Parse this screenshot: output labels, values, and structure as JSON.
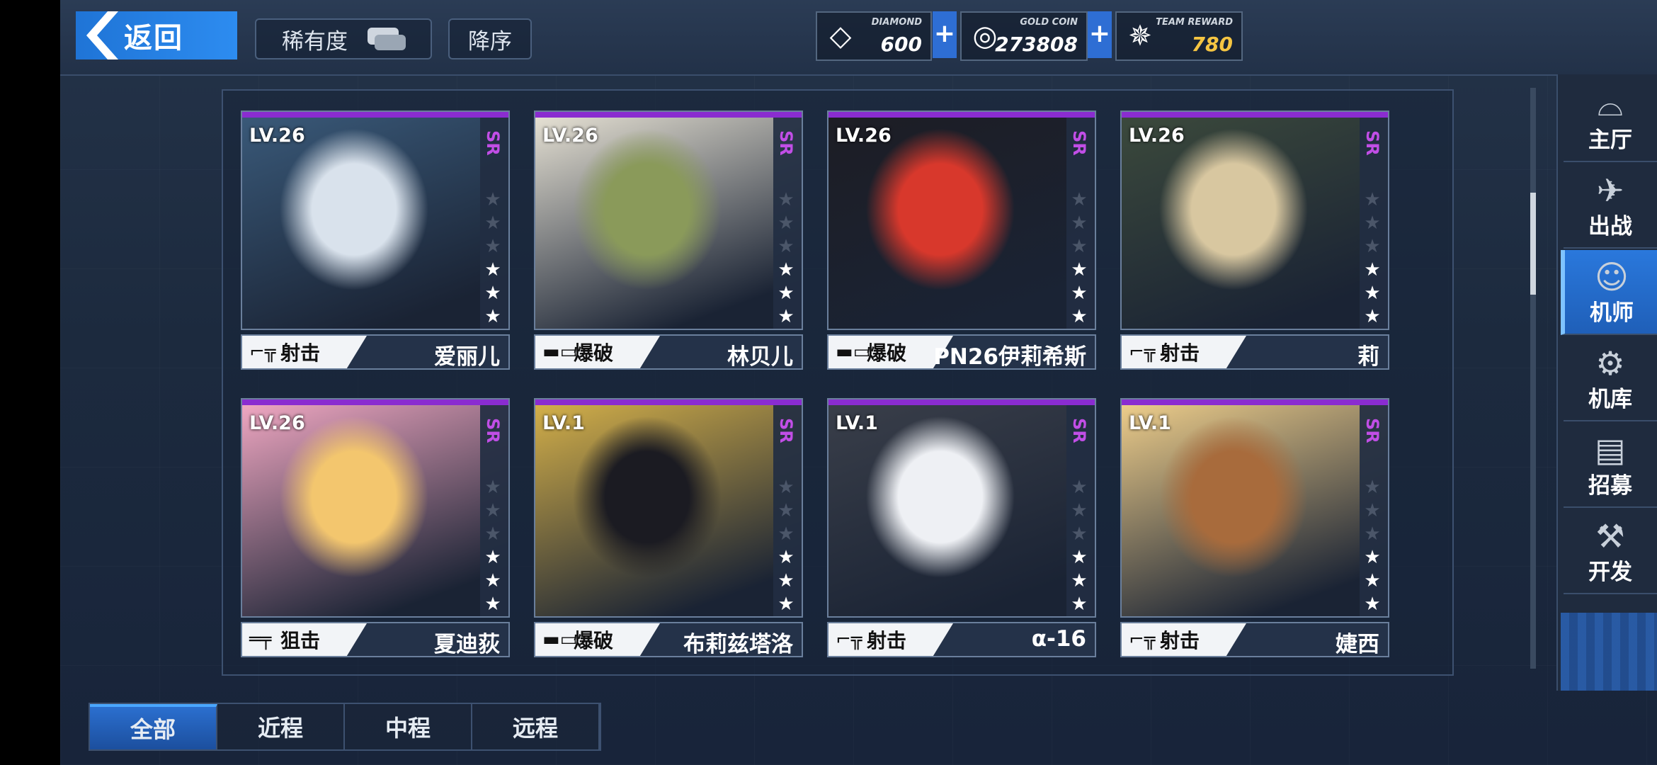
{
  "header": {
    "back_label": "返回",
    "rarity_label": "稀有度",
    "order_label": "降序"
  },
  "resources": {
    "diamond": {
      "caption": "DIAMOND",
      "value": "600"
    },
    "gold": {
      "caption": "GOLD COIN",
      "value": "273808"
    },
    "reward": {
      "caption": "TEAM REWARD",
      "value": "780"
    }
  },
  "nav": [
    {
      "label": "主厅",
      "icon": "hall-icon"
    },
    {
      "label": "出战",
      "icon": "battle-icon"
    },
    {
      "label": "机师",
      "icon": "pilot-icon"
    },
    {
      "label": "机库",
      "icon": "hangar-icon"
    },
    {
      "label": "招募",
      "icon": "recruit-icon"
    },
    {
      "label": "开发",
      "icon": "develop-icon"
    }
  ],
  "active_nav": "机师",
  "cards": [
    {
      "level": "LV.26",
      "rarity": "SR",
      "stars": 3,
      "role": "射击",
      "name": "爱丽儿",
      "colors": [
        "#d9e2ec",
        "#3a5a7a"
      ]
    },
    {
      "level": "LV.26",
      "rarity": "SR",
      "stars": 3,
      "role": "爆破",
      "name": "林贝儿",
      "colors": [
        "#8a9a5a",
        "#e9e4d6"
      ]
    },
    {
      "level": "LV.26",
      "rarity": "SR",
      "stars": 3,
      "role": "爆破",
      "name": "PN26伊莉希斯",
      "colors": [
        "#d8382c",
        "#1d1d24"
      ]
    },
    {
      "level": "LV.26",
      "rarity": "SR",
      "stars": 3,
      "role": "射击",
      "name": "莉",
      "colors": [
        "#d8c7a0",
        "#3c4a3c"
      ]
    },
    {
      "level": "LV.26",
      "rarity": "SR",
      "stars": 3,
      "role": "狙击",
      "name": "夏迪荻",
      "colors": [
        "#f3c66e",
        "#f3a9c4"
      ]
    },
    {
      "level": "LV.1",
      "rarity": "SR",
      "stars": 3,
      "role": "爆破",
      "name": "布莉兹塔洛",
      "colors": [
        "#1b1b22",
        "#d7b24a"
      ]
    },
    {
      "level": "LV.1",
      "rarity": "SR",
      "stars": 3,
      "role": "射击",
      "name": "α-16",
      "colors": [
        "#eef0f4",
        "#3a3f4a"
      ]
    },
    {
      "level": "LV.1",
      "rarity": "SR",
      "stars": 3,
      "role": "射击",
      "name": "婕西",
      "colors": [
        "#a86b3c",
        "#f1d08c"
      ]
    }
  ],
  "tabs": [
    "全部",
    "近程",
    "中程",
    "远程"
  ],
  "active_tab": "全部"
}
